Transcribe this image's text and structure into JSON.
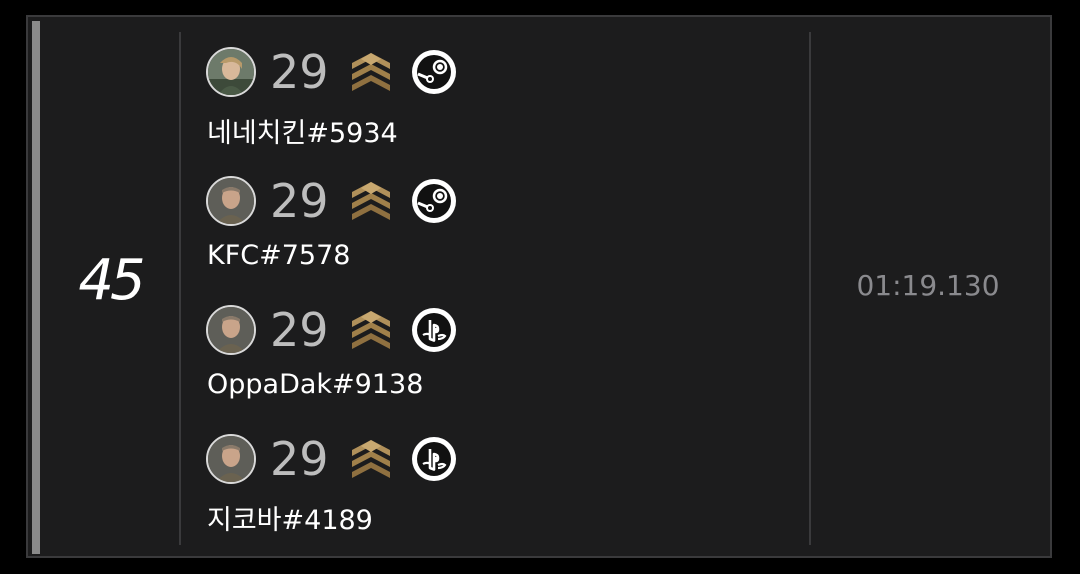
{
  "row": {
    "rank": "45",
    "time": "01:19.130",
    "players": [
      {
        "level": "29",
        "name": "네네치킨#5934",
        "avatar_icon": "character-portrait-icon",
        "rank_icon": "gold-chevron-rank-icon",
        "platform_icon": "steam-icon"
      },
      {
        "level": "29",
        "name": "KFC#7578",
        "avatar_icon": "character-portrait-icon",
        "rank_icon": "gold-chevron-rank-icon",
        "platform_icon": "steam-icon"
      },
      {
        "level": "29",
        "name": "OppaDak#9138",
        "avatar_icon": "character-portrait-icon",
        "rank_icon": "gold-chevron-rank-icon",
        "platform_icon": "playstation-icon"
      },
      {
        "level": "29",
        "name": "지코바#4189",
        "avatar_icon": "character-portrait-icon",
        "rank_icon": "gold-chevron-rank-icon",
        "platform_icon": "playstation-icon"
      }
    ]
  },
  "colors": {
    "background": "#000000",
    "card": "#1c1c1d",
    "border": "#3a3a3c",
    "accent_bar": "#8a8a8a",
    "rank_badge_gold": "#b0905a",
    "time_text": "#8a8a8e"
  }
}
